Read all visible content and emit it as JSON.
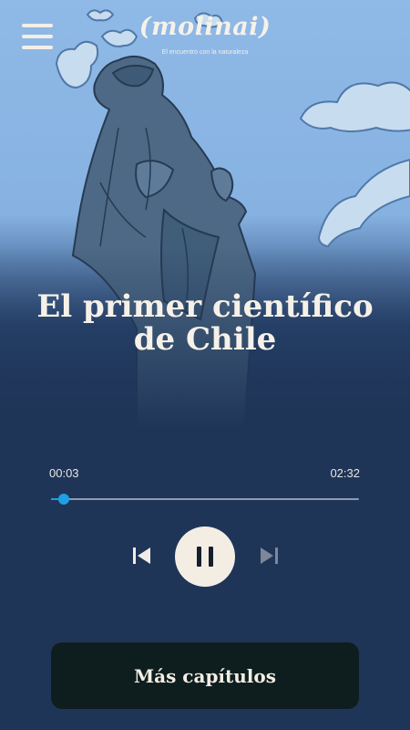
{
  "header": {
    "logo": "(molinai)",
    "tagline": "El encuentro con la naturaleza",
    "menu_icon": "hamburger-menu-icon"
  },
  "hero": {
    "title_line1": "El primer científico",
    "title_line2": "de Chile",
    "illustration": "statue-illustration"
  },
  "player": {
    "current_time": "00:03",
    "total_time": "02:32",
    "progress": 0.04,
    "prev_icon": "skip-previous-icon",
    "pause_icon": "pause-icon",
    "next_icon": "skip-next-icon",
    "accent_color": "#1fa0e4"
  },
  "footer": {
    "more_chapters_label": "Más capítulos"
  },
  "colors": {
    "background": "#1f3558",
    "sky": "#8fb9e6",
    "text": "#f6f1e8",
    "button_dark": "#0e1e1f"
  }
}
